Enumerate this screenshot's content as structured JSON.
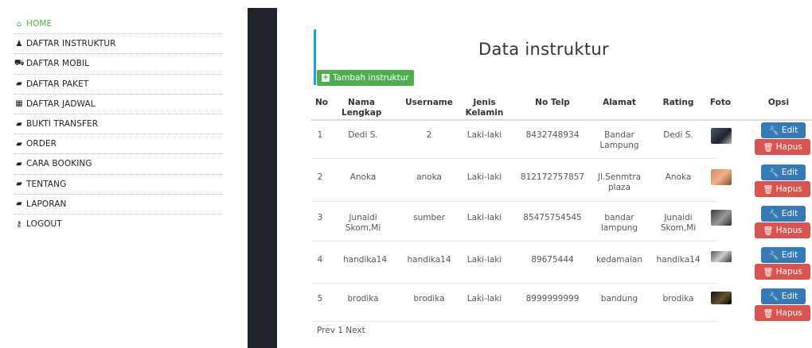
{
  "sidebar": {
    "items": [
      {
        "label": "HOME",
        "icon": "home-icon",
        "glyph": "⌂"
      },
      {
        "label": "DAFTAR INSTRUKTUR",
        "icon": "user-icon",
        "glyph": "♟"
      },
      {
        "label": "DAFTAR MOBIL",
        "icon": "car-icon",
        "glyph": "⛟"
      },
      {
        "label": "DAFTAR PAKET",
        "icon": "book-icon",
        "glyph": "▰"
      },
      {
        "label": "DAFTAR JADWAL",
        "icon": "calendar-icon",
        "glyph": "▦"
      },
      {
        "label": "BUKTI TRANSFER",
        "icon": "book-icon",
        "glyph": "▰"
      },
      {
        "label": "ORDER",
        "icon": "book-icon",
        "glyph": "▰"
      },
      {
        "label": "CARA BOOKING",
        "icon": "book-icon",
        "glyph": "▰"
      },
      {
        "label": "TENTANG",
        "icon": "book-icon",
        "glyph": "▰"
      },
      {
        "label": "LAPORAN",
        "icon": "book-icon",
        "glyph": "▰"
      },
      {
        "label": "LOGOUT",
        "icon": "key-icon",
        "glyph": "⚷"
      }
    ]
  },
  "main": {
    "title": "Data instruktur",
    "add_button": "Tambah instruktur",
    "table": {
      "headers": {
        "no": "No",
        "nama": "Nama Lengkap",
        "username": "Username",
        "jenis": "Jenis Kelamin",
        "telp": "No Telp",
        "alamat": "Alamat",
        "rating": "Rating",
        "foto": "Foto",
        "opsi": "Opsi"
      },
      "rows": [
        {
          "no": "1",
          "nama": "Dedi S.",
          "username": "2",
          "jenis": "Laki-laki",
          "telp": "8432748934",
          "alamat": "Bandar Lampung",
          "rating": "Dedi S."
        },
        {
          "no": "2",
          "nama": "Anoka",
          "username": "anoka",
          "jenis": "Laki-laki",
          "telp": "812172757857",
          "alamat": "Jl.Senmtra plaza",
          "rating": "Anoka"
        },
        {
          "no": "3",
          "nama": "Junaidi Skom,Mi",
          "username": "sumber",
          "jenis": "Laki-laki",
          "telp": "85475754545",
          "alamat": "bandar lampung",
          "rating": "Junaidi Skom,Mi"
        },
        {
          "no": "4",
          "nama": "handika14",
          "username": "handika14",
          "jenis": "Laki-laki",
          "telp": "89675444",
          "alamat": "kedamaian",
          "rating": "handika14"
        },
        {
          "no": "5",
          "nama": "brodika",
          "username": "brodika",
          "jenis": "Laki-laki",
          "telp": "8999999999",
          "alamat": "bandung",
          "rating": "brodika"
        }
      ],
      "edit_label": "Edit",
      "delete_label": "Hapus"
    },
    "pager": {
      "prev": "Prev",
      "page": "1",
      "next": "Next"
    }
  },
  "colors": {
    "accent_green": "#4cae4c",
    "edit_blue": "#337ab7",
    "delete_red": "#d9534f",
    "title_bar": "#1aa3d6",
    "dark_strip": "#1f232b"
  }
}
